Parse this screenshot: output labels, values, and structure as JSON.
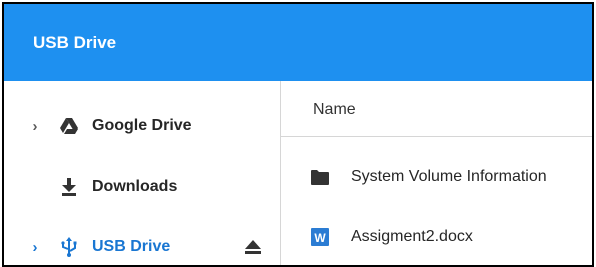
{
  "window": {
    "title": "USB Drive"
  },
  "sidebar": {
    "items": [
      {
        "label": "Google Drive",
        "icon": "google-drive-icon",
        "expandable": true
      },
      {
        "label": "Downloads",
        "icon": "download-icon",
        "expandable": false
      },
      {
        "label": "USB Drive",
        "icon": "usb-icon",
        "expandable": true,
        "selected": true,
        "ejectable": true
      }
    ]
  },
  "file_list": {
    "columns": [
      "Name"
    ],
    "rows": [
      {
        "name": "System Volume Information",
        "icon": "folder-icon"
      },
      {
        "name": "Assigment2.docx",
        "icon": "word-document-icon"
      }
    ]
  },
  "colors": {
    "title_bar": "#1e90f0",
    "accent": "#1976d2",
    "word_icon": "#2b7cd3"
  }
}
